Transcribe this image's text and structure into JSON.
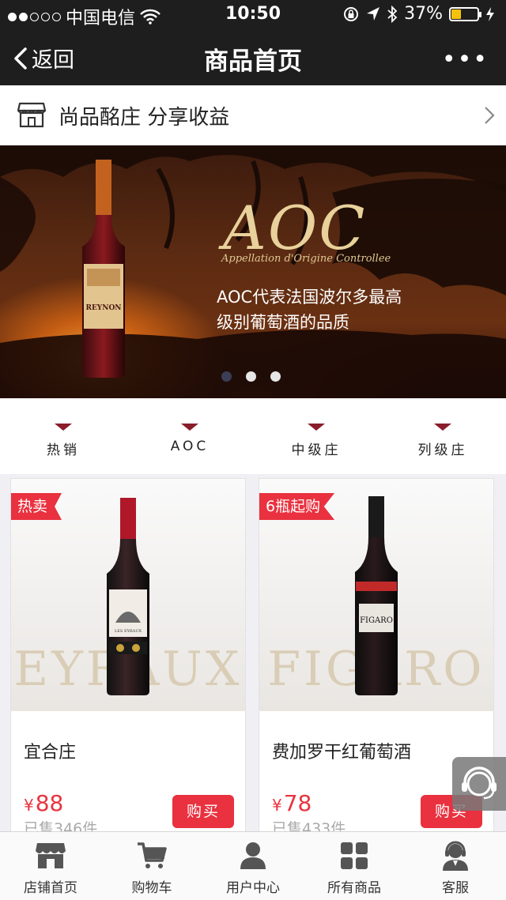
{
  "status_bar": {
    "carrier": "中国电信",
    "time": "10:50",
    "battery": "37%",
    "battery_level": 0.37
  },
  "nav": {
    "back_label": "返回",
    "title": "商品首页",
    "more_label": "•••"
  },
  "store": {
    "name": "尚品酩庄 分享收益"
  },
  "banner": {
    "title": "AOC",
    "subtitle": "Appellation d'Origine Controllee",
    "line1": "AOC代表法国波尔多最高",
    "line2": "级别葡萄酒的品质",
    "bottle_label": "REYNON",
    "slides_total": 3,
    "slide_active": 1
  },
  "categories": [
    {
      "label": "热销"
    },
    {
      "label": "AOC"
    },
    {
      "label": "中级庄"
    },
    {
      "label": "列级庄"
    }
  ],
  "products": [
    {
      "tag": "热卖",
      "bg_word": "EYRAUX",
      "label_word": "LES EYRAUX",
      "name": "宜合庄",
      "currency": "¥",
      "price": "88",
      "sold": "已售346件",
      "buy_label": "购买"
    },
    {
      "tag": "6瓶起购",
      "bg_word": "FIGARO",
      "label_word": "FIGARO",
      "name": "费加罗干红葡萄酒",
      "currency": "¥",
      "price": "78",
      "sold": "已售433件",
      "buy_label": "购买"
    }
  ],
  "tabbar": [
    {
      "label": "店铺首页",
      "icon": "shop-icon"
    },
    {
      "label": "购物车",
      "icon": "cart-icon"
    },
    {
      "label": "用户中心",
      "icon": "user-icon"
    },
    {
      "label": "所有商品",
      "icon": "grid-icon"
    },
    {
      "label": "客服",
      "icon": "service-icon"
    }
  ],
  "colors": {
    "accent": "#e9313f",
    "nav_bg": "#1e1e1e",
    "category_marker": "#8a1d2a"
  }
}
